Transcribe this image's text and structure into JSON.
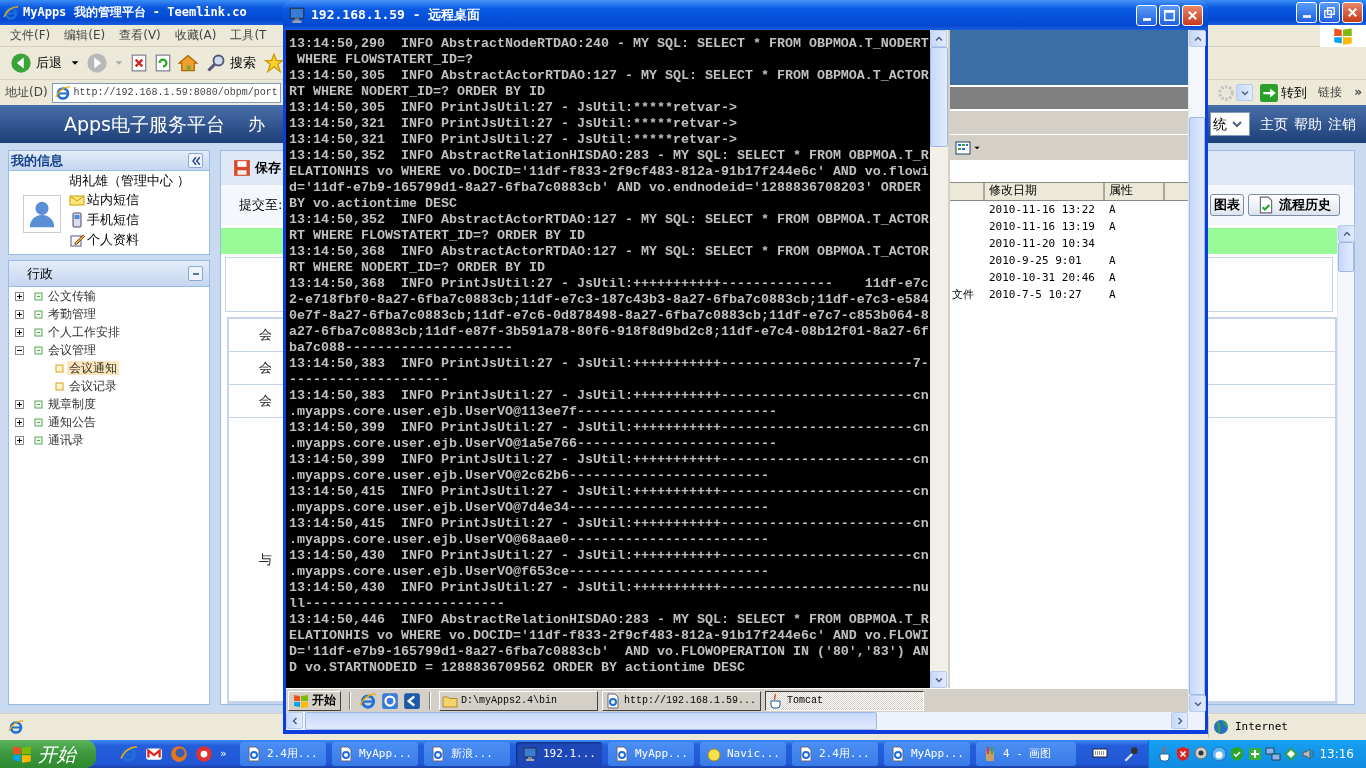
{
  "browser": {
    "title": "MyApps 我的管理平台 - Teemlink.co",
    "menu": [
      "文件(F)",
      "编辑(E)",
      "查看(V)",
      "收藏(A)",
      "工具(T"
    ],
    "back": "后退",
    "search": "搜索",
    "address_label": "地址(D)",
    "address": "http://192.168.1.59:8080/obpm/port",
    "go": "转到",
    "links": "链接",
    "links_more": "»",
    "status_zone": "Internet"
  },
  "app": {
    "logo": "Apps电子服务平台",
    "nav": "办",
    "system": "统",
    "top_links": [
      "主页",
      "帮助",
      "注销"
    ],
    "my_info": {
      "title": "我的信息",
      "user": "胡礼雄（管理中心 ）",
      "links": [
        "站内短信",
        "手机短信",
        "个人资料"
      ]
    },
    "tree": {
      "title": "行政",
      "items": [
        {
          "label": "公文传输",
          "expanded": false,
          "selected": false
        },
        {
          "label": "考勤管理",
          "expanded": false,
          "selected": false
        },
        {
          "label": "个人工作安排",
          "expanded": false,
          "selected": false
        },
        {
          "label": "会议管理",
          "expanded": true,
          "selected": false,
          "children": [
            {
              "label": "会议通知",
              "selected": true
            },
            {
              "label": "会议记录",
              "selected": false
            }
          ]
        },
        {
          "label": "规章制度",
          "expanded": false,
          "selected": false
        },
        {
          "label": "通知公告",
          "expanded": false,
          "selected": false
        },
        {
          "label": "通讯录",
          "expanded": false,
          "selected": false
        }
      ]
    },
    "form": {
      "save": "保存",
      "submit_to": "提交至:",
      "rows": [
        "会",
        "会",
        "会",
        "与"
      ],
      "buttons": [
        "图表",
        "流程历史"
      ]
    }
  },
  "remote": {
    "title": "192.168.1.59 - 远程桌面",
    "console_lines": [
      "13:14:50,290  INFO AbstractNodeRTDAO:240 - MY SQL: SELECT * FROM OBPMOA.T_NODERT",
      " WHERE FLOWSTATERT_ID=?",
      "13:14:50,305  INFO AbstractActorRTDAO:127 - MY SQL: SELECT * FROM OBPMOA.T_ACTOR",
      "RT WHERE NODERT_ID=? ORDER BY ID",
      "13:14:50,305  INFO PrintJsUtil:27 - JsUtil:*****retvar->",
      "13:14:50,321  INFO PrintJsUtil:27 - JsUtil:*****retvar->",
      "13:14:50,321  INFO PrintJsUtil:27 - JsUtil:*****retvar->",
      "13:14:50,352  INFO AbstractRelationHISDAO:283 - MY SQL: SELECT * FROM OBPMOA.T_R",
      "ELATIONHIS vo WHERE vo.DOCID='11df-f833-2f9cf483-812a-91b17f244e6c' AND vo.flowi",
      "d='11df-e7b9-165799d1-8a27-6fba7c0883cb' AND vo.endnodeid='1288836708203' ORDER",
      "BY vo.actiontime DESC",
      "13:14:50,352  INFO AbstractActorRTDAO:127 - MY SQL: SELECT * FROM OBPMOA.T_ACTOR",
      "RT WHERE FLOWSTATERT_ID=? ORDER BY ID",
      "13:14:50,368  INFO AbstractActorRTDAO:127 - MY SQL: SELECT * FROM OBPMOA.T_ACTOR",
      "RT WHERE NODERT_ID=? ORDER BY ID",
      "13:14:50,368  INFO PrintJsUtil:27 - JsUtil:+++++++++++--------------    11df-e7c",
      "2-e718fbf0-8a27-6fba7c0883cb;11df-e7c3-187c43b3-8a27-6fba7c0883cb;11df-e7c3-e584",
      "0e7f-8a27-6fba7c0883cb;11df-e7c6-0d878498-8a27-6fba7c0883cb;11df-e7c7-c853b064-8",
      "a27-6fba7c0883cb;11df-e87f-3b591a78-80f6-918f8d9bd2c8;11df-e7c4-08b12f01-8a27-6f",
      "ba7c088---------------------",
      "13:14:50,383  INFO PrintJsUtil:27 - JsUtil:+++++++++++------------------------7-",
      "--------------------",
      "13:14:50,383  INFO PrintJsUtil:27 - JsUtil:+++++++++++------------------------cn",
      ".myapps.core.user.ejb.UserVO@113ee7f-------------------------",
      "13:14:50,399  INFO PrintJsUtil:27 - JsUtil:+++++++++++------------------------cn",
      ".myapps.core.user.ejb.UserVO@1a5e766-------------------------",
      "13:14:50,399  INFO PrintJsUtil:27 - JsUtil:+++++++++++------------------------cn",
      ".myapps.core.user.ejb.UserVO@2c62b6-------------------------",
      "13:14:50,415  INFO PrintJsUtil:27 - JsUtil:+++++++++++------------------------cn",
      ".myapps.core.user.ejb.UserVO@7d4e34-------------------------",
      "13:14:50,415  INFO PrintJsUtil:27 - JsUtil:+++++++++++------------------------cn",
      ".myapps.core.user.ejb.UserVO@68aae0-------------------------",
      "13:14:50,430  INFO PrintJsUtil:27 - JsUtil:+++++++++++------------------------cn",
      ".myapps.core.user.ejb.UserVO@f653ce-------------------------",
      "13:14:50,430  INFO PrintJsUtil:27 - JsUtil:+++++++++++------------------------nu",
      "ll-------------------------",
      "13:14:50,446  INFO AbstractRelationHISDAO:283 - MY SQL: SELECT * FROM OBPMOA.T_R",
      "ELATIONHIS vo WHERE vo.DOCID='11df-f833-2f9cf483-812a-91b17f244e6c' AND vo.FLOWI",
      "D='11df-e7b9-165799d1-8a27-6fba7c0883cb'  AND vo.FLOWOPERATION IN ('80','83') AN",
      "D vo.STARTNODEID = 1288836709562 ORDER BY actiontime DESC"
    ],
    "explorer": {
      "columns": [
        "修改日期",
        "属性"
      ],
      "rows": [
        {
          "modified": "2010-11-16 13:22",
          "attr": "A"
        },
        {
          "modified": "2010-11-16 13:19",
          "attr": "A"
        },
        {
          "modified": "2010-11-20 10:34"
        },
        {
          "modified": "2010-9-25 9:01",
          "attr": "A"
        },
        {
          "modified": "2010-10-31 20:46",
          "attr": "A"
        },
        {
          "name": "文件",
          "modified": "2010-7-5 10:27",
          "attr": "A"
        }
      ]
    },
    "taskbar": {
      "start": "开始",
      "tasks": [
        {
          "label": "D:\\myApps2.4\\bin",
          "kind": "folder",
          "selected": false
        },
        {
          "label": "http://192.168.1.59...",
          "kind": "browser",
          "selected": false
        },
        {
          "label": "Tomcat",
          "kind": "java",
          "selected": true
        }
      ]
    }
  },
  "taskbar": {
    "start": "开始",
    "quick_more": "»",
    "tasks": [
      {
        "label": "2.4用...",
        "kind": "browser",
        "selected": false
      },
      {
        "label": "MyApp...",
        "kind": "browser",
        "selected": false
      },
      {
        "label": "新浪...",
        "kind": "browser",
        "selected": false
      },
      {
        "label": "192.1...",
        "kind": "remote",
        "selected": true
      },
      {
        "label": "MyApp...",
        "kind": "browser",
        "selected": false
      },
      {
        "label": "Navic...",
        "kind": "navicat",
        "selected": false
      },
      {
        "label": "2.4用...",
        "kind": "browser",
        "selected": false
      },
      {
        "label": "MyApp...",
        "kind": "browser",
        "selected": false
      },
      {
        "label": "4 - 画图",
        "kind": "paint",
        "selected": false
      }
    ],
    "clock": "13:16"
  }
}
